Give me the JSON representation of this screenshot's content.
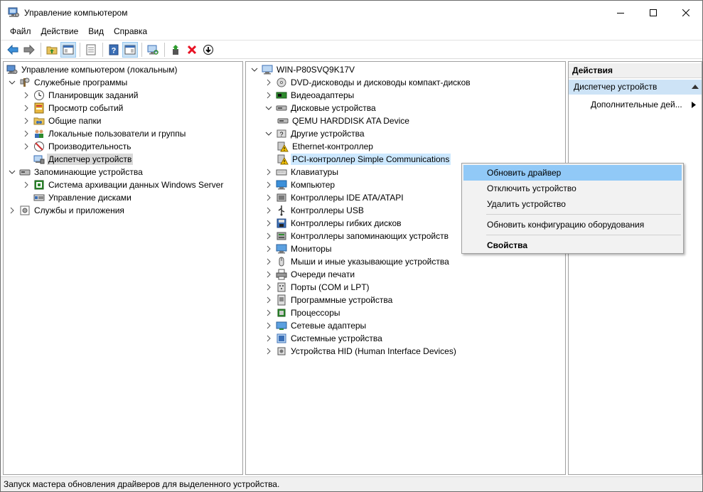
{
  "window": {
    "title": "Управление компьютером"
  },
  "menu": [
    "Файл",
    "Действие",
    "Вид",
    "Справка"
  ],
  "left_tree": {
    "root": "Управление компьютером (локальным)",
    "items": [
      {
        "label": "Служебные программы",
        "level": 1,
        "expanded": true,
        "icon": "tools-icon"
      },
      {
        "label": "Планировщик заданий",
        "level": 2,
        "icon": "clock-icon"
      },
      {
        "label": "Просмотр событий",
        "level": 2,
        "icon": "event-viewer-icon"
      },
      {
        "label": "Общие папки",
        "level": 2,
        "icon": "shared-folder-icon"
      },
      {
        "label": "Локальные пользователи и группы",
        "level": 2,
        "icon": "users-icon"
      },
      {
        "label": "Производительность",
        "level": 2,
        "icon": "performance-icon"
      },
      {
        "label": "Диспетчер устройств",
        "level": 2,
        "icon": "device-manager-icon",
        "selected": true
      },
      {
        "label": "Запоминающие устройства",
        "level": 1,
        "expanded": true,
        "icon": "storage-icon"
      },
      {
        "label": "Система архивации данных Windows Server",
        "level": 2,
        "icon": "backup-icon"
      },
      {
        "label": "Управление дисками",
        "level": 2,
        "icon": "disk-management-icon"
      },
      {
        "label": "Службы и приложения",
        "level": 1,
        "icon": "services-icon"
      }
    ]
  },
  "device_tree": {
    "root": "WIN-P80SVQ9K17V",
    "items": [
      {
        "label": "DVD-дисководы и дисководы компакт-дисков",
        "level": 1,
        "icon": "dvd-icon"
      },
      {
        "label": "Видеоадаптеры",
        "level": 1,
        "icon": "display-adapter-icon"
      },
      {
        "label": "Дисковые устройства",
        "level": 1,
        "expanded": true,
        "icon": "disk-drive-icon"
      },
      {
        "label": "QEMU HARDDISK ATA Device",
        "level": 2,
        "icon": "disk-drive-icon"
      },
      {
        "label": "Другие устройства",
        "level": 1,
        "expanded": true,
        "icon": "unknown-device-icon"
      },
      {
        "label": "Ethernet-контроллер",
        "level": 2,
        "icon": "warning-device-icon"
      },
      {
        "label": "PCI-контроллер Simple Communications",
        "level": 2,
        "icon": "warning-device-icon",
        "highlighted": true
      },
      {
        "label": "Клавиатуры",
        "level": 1,
        "icon": "keyboard-icon"
      },
      {
        "label": "Компьютер",
        "level": 1,
        "icon": "computer-icon"
      },
      {
        "label": "Контроллеры IDE ATA/ATAPI",
        "level": 1,
        "icon": "ide-controller-icon"
      },
      {
        "label": "Контроллеры USB",
        "level": 1,
        "icon": "usb-icon"
      },
      {
        "label": "Контроллеры гибких дисков",
        "level": 1,
        "icon": "floppy-controller-icon"
      },
      {
        "label": "Контроллеры запоминающих устройств",
        "level": 1,
        "icon": "storage-controller-icon"
      },
      {
        "label": "Мониторы",
        "level": 1,
        "icon": "monitor-icon"
      },
      {
        "label": "Мыши и иные указывающие устройства",
        "level": 1,
        "icon": "mouse-icon"
      },
      {
        "label": "Очереди печати",
        "level": 1,
        "icon": "printer-icon"
      },
      {
        "label": "Порты (COM и LPT)",
        "level": 1,
        "icon": "port-icon"
      },
      {
        "label": "Программные устройства",
        "level": 1,
        "icon": "software-device-icon"
      },
      {
        "label": "Процессоры",
        "level": 1,
        "icon": "processor-icon"
      },
      {
        "label": "Сетевые адаптеры",
        "level": 1,
        "icon": "network-adapter-icon"
      },
      {
        "label": "Системные устройства",
        "level": 1,
        "icon": "system-device-icon"
      },
      {
        "label": "Устройства HID (Human Interface Devices)",
        "level": 1,
        "icon": "hid-icon"
      }
    ]
  },
  "actions": {
    "header": "Действия",
    "section": "Диспетчер устройств",
    "item": "Дополнительные дей..."
  },
  "context_menu": {
    "items": [
      {
        "label": "Обновить драйвер",
        "hover": true
      },
      {
        "label": "Отключить устройство"
      },
      {
        "label": "Удалить устройство"
      },
      {
        "label": "Обновить конфигурацию оборудования"
      },
      {
        "label": "Свойства",
        "bold": true
      }
    ]
  },
  "status": "Запуск мастера обновления драйверов для выделенного устройства.",
  "colors": {
    "selection_gray": "#d9d9d9",
    "highlight_blue": "#cce8ff",
    "menu_hover": "#91c9f7",
    "delete_red": "#e81123"
  }
}
